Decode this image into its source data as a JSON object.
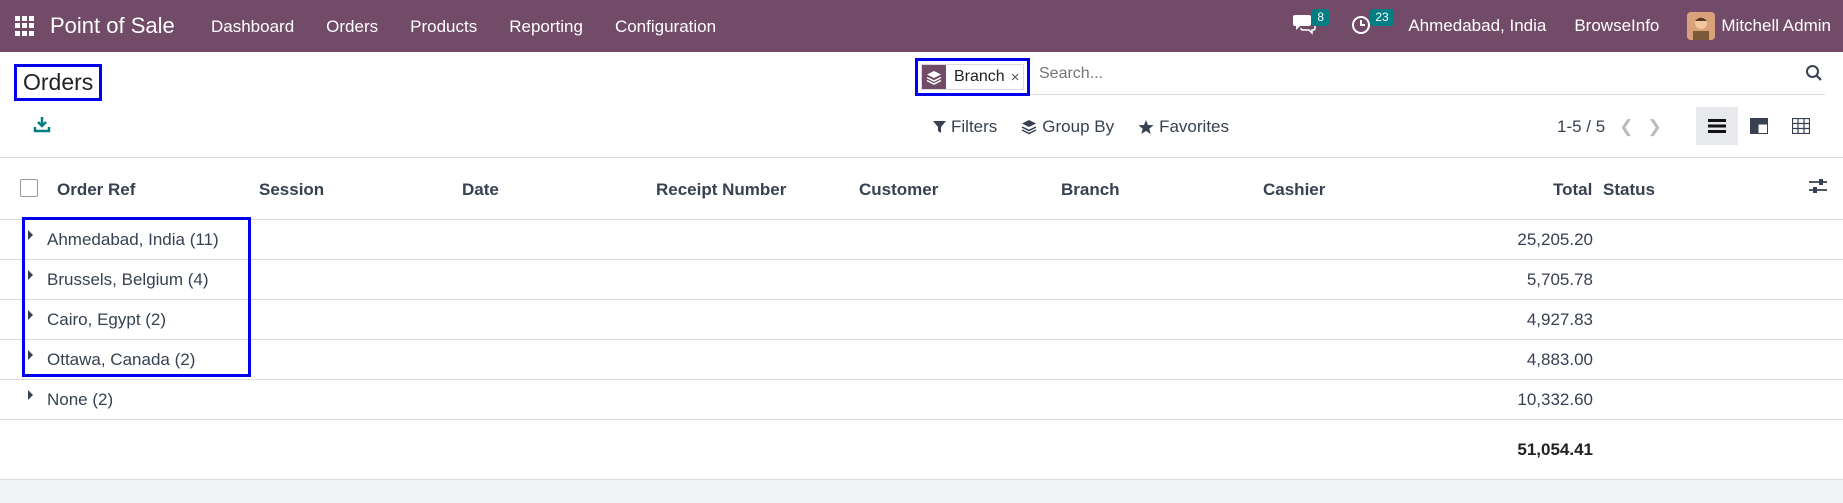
{
  "navbar": {
    "app_title": "Point of Sale",
    "menu": [
      "Dashboard",
      "Orders",
      "Products",
      "Reporting",
      "Configuration"
    ],
    "messages_count": "8",
    "activities_count": "23",
    "company_location": "Ahmedabad, India",
    "company": "BrowseInfo",
    "user": "Mitchell Admin"
  },
  "page": {
    "title": "Orders"
  },
  "search": {
    "facet_label": "Branch",
    "facet_close": "×",
    "placeholder": "Search..."
  },
  "toolbar": {
    "filters": "Filters",
    "group_by": "Group By",
    "favorites": "Favorites",
    "pager": "1-5 / 5"
  },
  "table": {
    "columns": [
      "Order Ref",
      "Session",
      "Date",
      "Receipt Number",
      "Customer",
      "Branch",
      "Cashier",
      "Total",
      "Status"
    ],
    "groups": [
      {
        "name": "Ahmedabad, India (11)",
        "total": "25,205.20"
      },
      {
        "name": "Brussels, Belgium (4)",
        "total": "5,705.78"
      },
      {
        "name": "Cairo, Egypt (2)",
        "total": "4,927.83"
      },
      {
        "name": "Ottawa, Canada (2)",
        "total": "4,883.00"
      },
      {
        "name": "None (2)",
        "total": "10,332.60"
      }
    ],
    "grand_total": "51,054.41"
  },
  "colors": {
    "navbar": "#714b67",
    "accent": "#017e84",
    "highlight": "#0000ee"
  }
}
